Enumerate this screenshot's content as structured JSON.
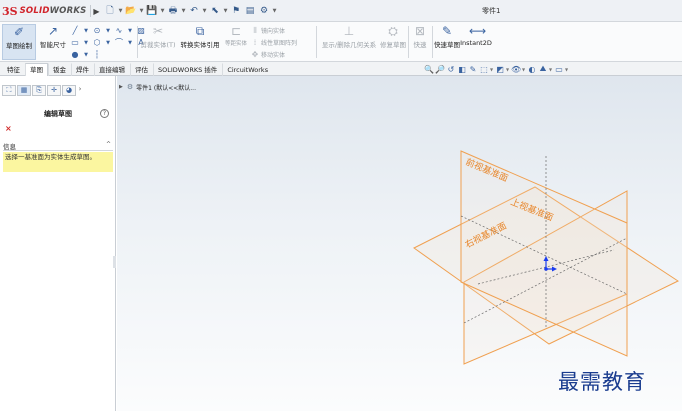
{
  "app": {
    "logo_ds": "3S",
    "logo_text_left": "SOLID",
    "logo_text_right": "WORKS",
    "menu_arrow": "▶",
    "document_title": "零件1"
  },
  "quick_access": [
    {
      "icon": "new-document-icon",
      "glyph": "🗋"
    },
    {
      "icon": "open-icon",
      "glyph": "📂"
    },
    {
      "icon": "save-icon",
      "glyph": "💾"
    },
    {
      "icon": "print-icon",
      "glyph": "🖶"
    },
    {
      "icon": "undo-icon",
      "glyph": "↶"
    },
    {
      "icon": "select-icon",
      "glyph": "⬉"
    },
    {
      "icon": "rebuild-icon",
      "glyph": "⚑"
    },
    {
      "icon": "file-properties-icon",
      "glyph": "▤"
    },
    {
      "icon": "options-gear-icon",
      "glyph": "⚙"
    }
  ],
  "commands": {
    "sketch": "草图绘制",
    "smart_dimension": "智能尺寸",
    "trim_entities": "剪裁实体(T)",
    "convert_entities": "转换实体引用",
    "offset_entities": "等距实体",
    "mirror_entities": "镜向实体",
    "linear_pattern": "线性草图阵列",
    "move_entities": "移动实体",
    "display_relations": "显示/删除几何关系",
    "repair_sketch": "修复草图",
    "quick_snaps": "快速",
    "rapid_sketch": "快速草图",
    "instant2d": "Instant2D"
  },
  "tabs": [
    {
      "label": "特征",
      "active": false
    },
    {
      "label": "草图",
      "active": true
    },
    {
      "label": "钣金",
      "active": false
    },
    {
      "label": "焊件",
      "active": false
    },
    {
      "label": "直接编辑",
      "active": false
    },
    {
      "label": "评估",
      "active": false
    },
    {
      "label": "SOLIDWORKS 插件",
      "active": false
    },
    {
      "label": "CircuitWorks",
      "active": false
    }
  ],
  "view_tools": [
    {
      "icon": "zoom-to-fit-icon",
      "glyph": "🔍"
    },
    {
      "icon": "zoom-area-icon",
      "glyph": "🔎"
    },
    {
      "icon": "previous-view-icon",
      "glyph": "↺"
    },
    {
      "icon": "section-view-icon",
      "glyph": "◧"
    },
    {
      "icon": "dynamic-annotation-icon",
      "glyph": "✎"
    },
    {
      "icon": "view-orientation-icon",
      "glyph": "⬚"
    },
    {
      "icon": "display-style-icon",
      "glyph": "◩"
    },
    {
      "icon": "hide-show-items-icon",
      "glyph": "👁"
    },
    {
      "icon": "edit-appearance-icon",
      "glyph": "◐"
    },
    {
      "icon": "scene-icon",
      "glyph": "⛰"
    },
    {
      "icon": "view-settings-icon",
      "glyph": "▭"
    }
  ],
  "left_pane": {
    "tabs": [
      "feature-manager-icon",
      "property-manager-icon",
      "configuration-manager-icon",
      "dimxpert-icon",
      "display-manager-icon"
    ],
    "title": "编辑草图",
    "help": "?",
    "close": "×",
    "message_header": "信息",
    "message_collapse": "^",
    "message_text": "选择一基准面为实体生成草图。"
  },
  "graphics": {
    "tree_label": "零件1 (默认<<默认...",
    "planes": {
      "front": "前视基准面",
      "top": "上视基准面",
      "right": "右视基准面"
    },
    "plane_color": "#f0a050",
    "plane_label_color": "#e8862a",
    "origin_color": "#1a3cf0"
  },
  "watermark": "最需教育"
}
